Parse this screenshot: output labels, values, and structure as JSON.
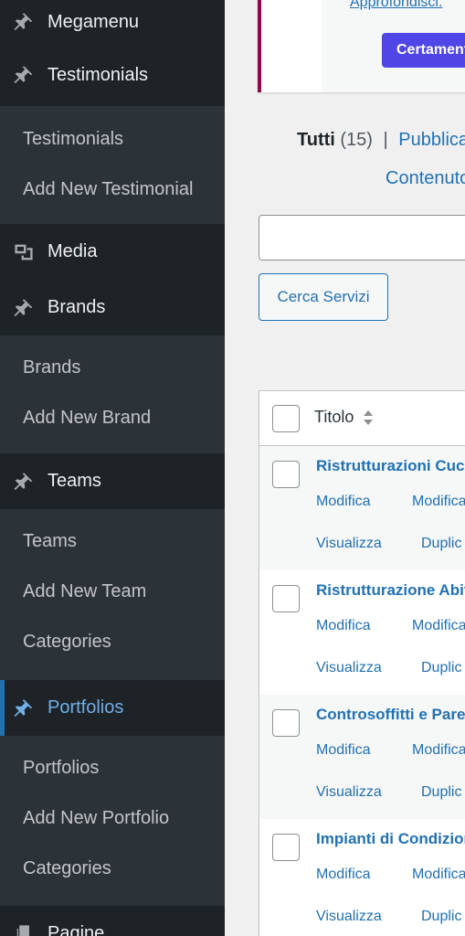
{
  "sidebar": {
    "items": [
      {
        "label": "Megamenu"
      },
      {
        "label": "Testimonials",
        "submenu": [
          "Testimonials",
          "Add New Testimonial"
        ]
      },
      {
        "label": "Media"
      },
      {
        "label": "Brands",
        "submenu": [
          "Brands",
          "Add New Brand"
        ]
      },
      {
        "label": "Teams",
        "submenu": [
          "Teams",
          "Add New Team",
          "Categories"
        ]
      },
      {
        "label": "Portfolios",
        "submenu": [
          "Portfolios",
          "Add New Portfolio",
          "Categories"
        ]
      },
      {
        "label": "Pagine"
      }
    ]
  },
  "notice": {
    "link": "Approfondisci.",
    "cta": "Certamente! Vo"
  },
  "filters": {
    "all_label": "Tutti",
    "all_count": "(15)",
    "separator": "|",
    "published": "Pubblica",
    "content": "Contenuto"
  },
  "search": {
    "value": "",
    "button": "Cerca Servizi"
  },
  "table": {
    "header_title": "Titolo",
    "rows": [
      {
        "title": "Ristrutturazioni Cuci",
        "actions": [
          "Modifica",
          "Modifica",
          "Visualizza",
          "Duplic"
        ]
      },
      {
        "title": "Ristrutturazione Abit",
        "actions": [
          "Modifica",
          "Modifica",
          "Visualizza",
          "Duplic"
        ]
      },
      {
        "title": "Controsoffitti e Pare",
        "actions": [
          "Modifica",
          "Modifica",
          "Visualizza",
          "Duplic"
        ]
      },
      {
        "title": "Impianti di Condizior",
        "actions": [
          "Modifica",
          "Modifica",
          "Visualizza",
          "Duplic"
        ]
      }
    ]
  },
  "colors": {
    "sidebar_bg": "#1d2327",
    "submenu_bg": "#2c3338",
    "accent": "#2271b1",
    "current_menu": "#72aee6",
    "cta_bg": "#4f46e5",
    "notice_border": "#8c0a4d"
  },
  "icons": {
    "pin": "pin-icon",
    "media": "media-icon",
    "pages": "pages-icon"
  }
}
